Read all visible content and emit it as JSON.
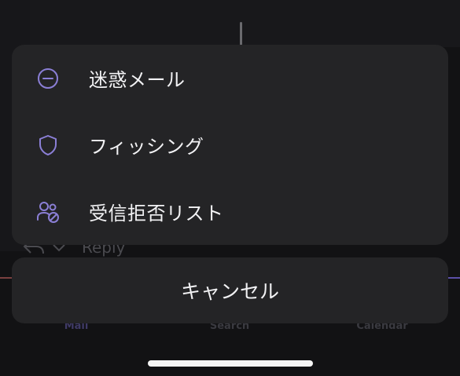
{
  "background": {
    "reply_label": "Reply",
    "tabs": {
      "mail": "Mail",
      "search": "Search",
      "calendar": "Calendar"
    }
  },
  "action_sheet": {
    "items": [
      {
        "label": "迷惑メール",
        "icon": "minus-circle-icon"
      },
      {
        "label": "フィッシング",
        "icon": "shield-icon"
      },
      {
        "label": "受信拒否リスト",
        "icon": "people-block-icon"
      }
    ],
    "cancel_label": "キャンセル"
  },
  "colors": {
    "accent": "#8b7fd6",
    "sheet_bg": "#242426",
    "text": "#f2f2f4"
  }
}
